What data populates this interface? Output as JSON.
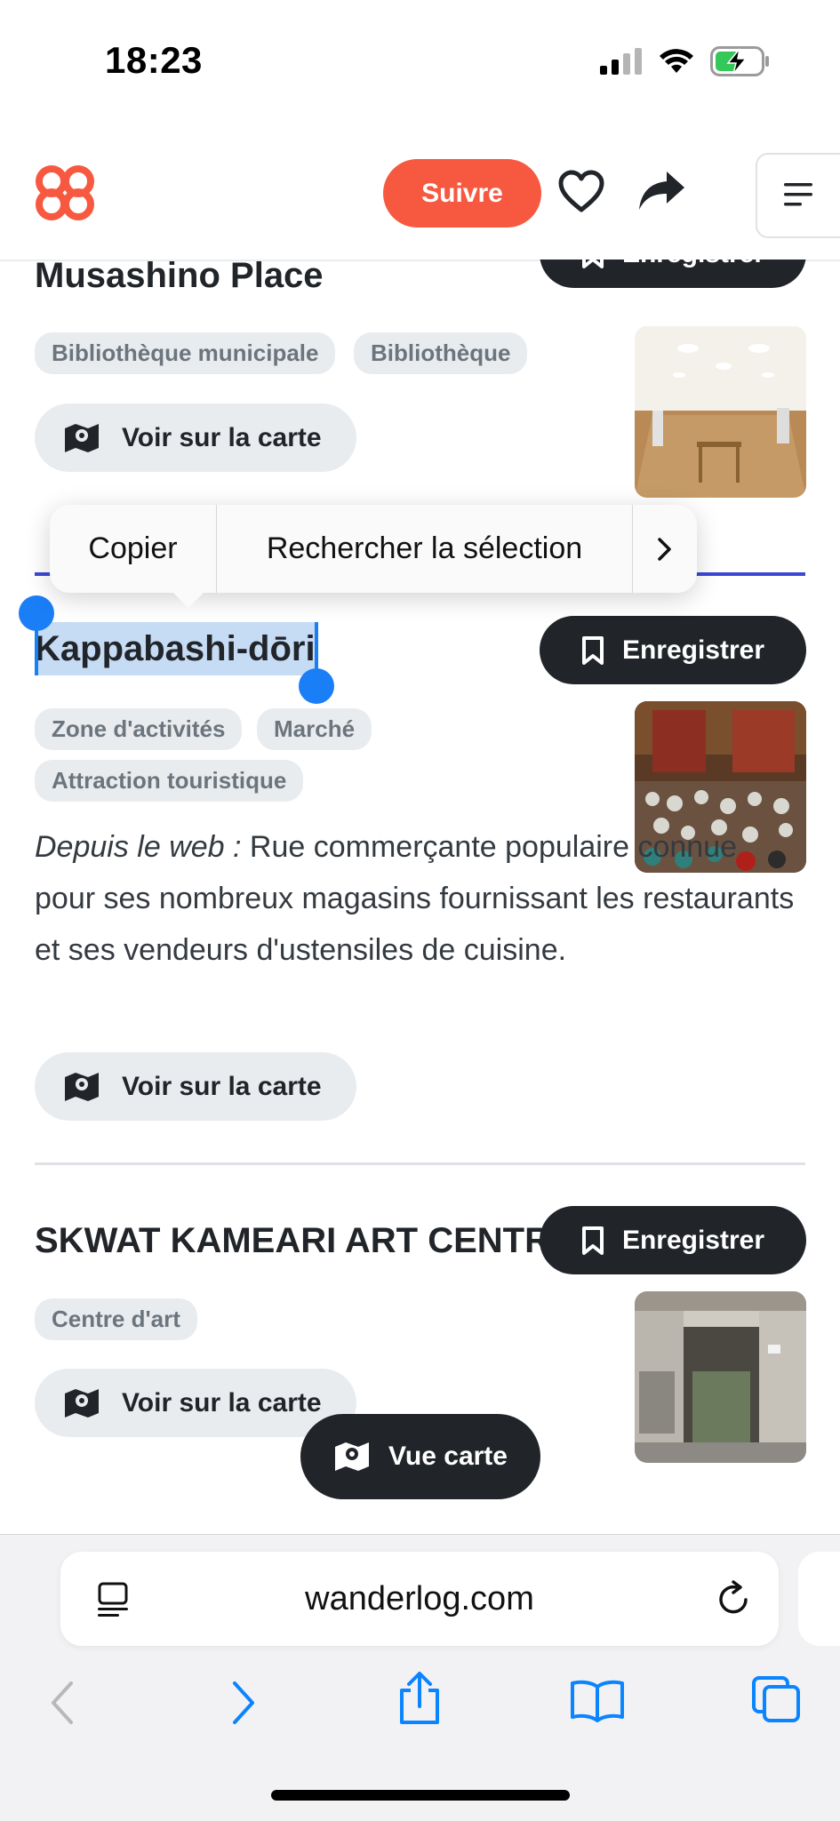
{
  "status_bar": {
    "time": "18:23"
  },
  "header": {
    "follow_label": "Suivre"
  },
  "places": [
    {
      "title": "Musashino Place",
      "save_label": "Enregistrer",
      "tags": [
        "Bibliothèque municipale",
        "Bibliothèque"
      ],
      "map_label": "Voir sur la carte"
    },
    {
      "title": "Kappabashi-dōri",
      "save_label": "Enregistrer",
      "tags": [
        "Zone d'activités",
        "Marché",
        "Attraction touristique"
      ],
      "description_prefix": "Depuis le web :",
      "description": " Rue commerçante populaire connue pour ses nombreux magasins fournissant les restaurants et ses vendeurs d'ustensiles de cuisine.",
      "map_label": "Voir sur la carte"
    },
    {
      "title": "SKWAT KAMEARI ART CENTRE",
      "save_label": "Enregistrer",
      "tags": [
        "Centre d'art"
      ],
      "map_label": "Voir sur la carte"
    }
  ],
  "context_menu": {
    "copy": "Copier",
    "lookup": "Rechercher la sélection"
  },
  "floating": {
    "map_view_label": "Vue carte"
  },
  "browser": {
    "url": "wanderlog.com"
  },
  "colors": {
    "accent": "#f75940",
    "dark": "#212529",
    "selection": "#1a7ef6",
    "ios_blue": "#0a84ff"
  }
}
